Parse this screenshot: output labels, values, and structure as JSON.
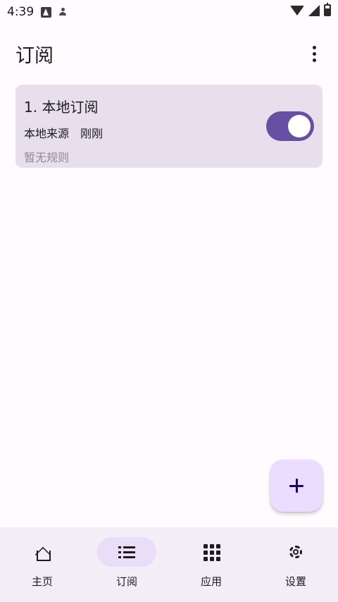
{
  "status_bar": {
    "time": "4:39"
  },
  "header": {
    "title": "订阅"
  },
  "subscriptions": [
    {
      "title": "1. 本地订阅",
      "source": "本地来源",
      "updated": "刚刚",
      "rule_status": "暂无规则",
      "enabled": true
    }
  ],
  "nav": {
    "items": [
      {
        "label": "主页",
        "icon": "home-icon",
        "active": false
      },
      {
        "label": "订阅",
        "icon": "list-icon",
        "active": true
      },
      {
        "label": "应用",
        "icon": "grid-icon",
        "active": false
      },
      {
        "label": "设置",
        "icon": "gear-icon",
        "active": false
      }
    ]
  },
  "colors": {
    "background": "#fffbfe",
    "card": "#e7e0ec",
    "accent": "#6750a4",
    "fab": "#eaddff",
    "nav_background": "#f3edf7",
    "nav_active": "#e8def8"
  }
}
